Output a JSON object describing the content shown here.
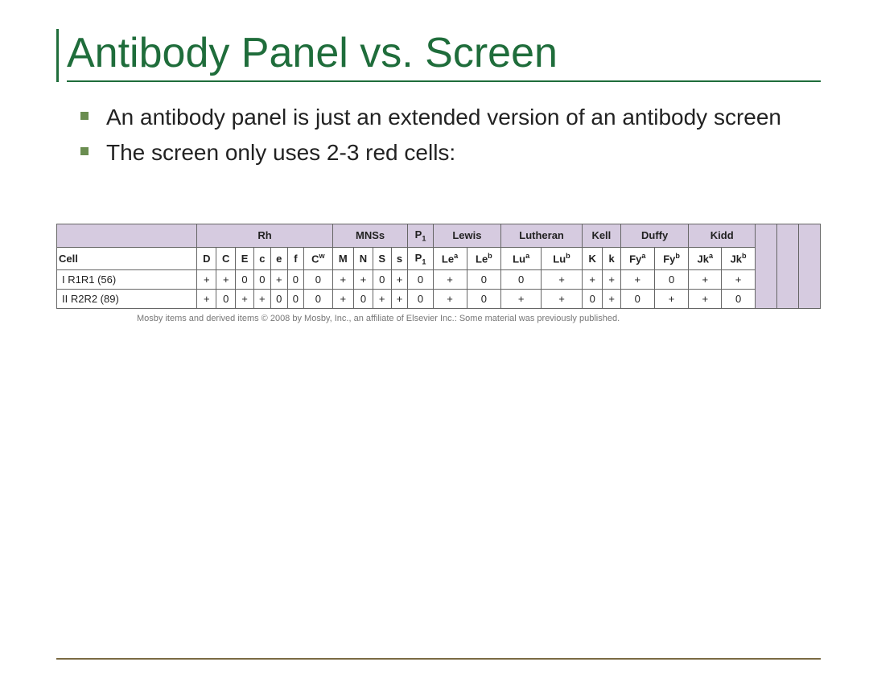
{
  "title": "Antibody Panel vs. Screen",
  "bullets": [
    "An antibody panel is just an extended version of an antibody screen",
    "The screen only uses 2-3 red cells:"
  ],
  "table": {
    "groups": [
      {
        "label": "Rh",
        "span": 7
      },
      {
        "label": "MNSs",
        "span": 4
      },
      {
        "label": "P1",
        "span": 1,
        "sub": true
      },
      {
        "label": "Lewis",
        "span": 2
      },
      {
        "label": "Lutheran",
        "span": 2
      },
      {
        "label": "Kell",
        "span": 2
      },
      {
        "label": "Duffy",
        "span": 2
      },
      {
        "label": "Kidd",
        "span": 2
      }
    ],
    "first_col_header": "Cell",
    "sub_headers": [
      "D",
      "C",
      "E",
      "c",
      "e",
      "f",
      "Cw",
      "M",
      "N",
      "S",
      "s",
      "P1",
      "Lea",
      "Leb",
      "Lua",
      "Lub",
      "K",
      "k",
      "Fya",
      "Fyb",
      "Jka",
      "Jkb"
    ],
    "rows": [
      {
        "label": "I  R1R1 (56)",
        "values": [
          "+",
          "+",
          "0",
          "0",
          "+",
          "0",
          "0",
          "+",
          "+",
          "0",
          "+",
          "0",
          "+",
          "0",
          "0",
          "+",
          "+",
          "+",
          "+",
          "0",
          "+",
          "+"
        ]
      },
      {
        "label": "II  R2R2 (89)",
        "values": [
          "+",
          "0",
          "+",
          "+",
          "0",
          "0",
          "0",
          "+",
          "0",
          "+",
          "+",
          "0",
          "+",
          "0",
          "+",
          "+",
          "0",
          "+",
          "0",
          "+",
          "+",
          "0"
        ]
      }
    ],
    "extra_cols": 3
  },
  "footer_note": "Mosby items and derived items © 2008 by Mosby, Inc., an affiliate of Elsevier Inc.: Some material was previously published."
}
